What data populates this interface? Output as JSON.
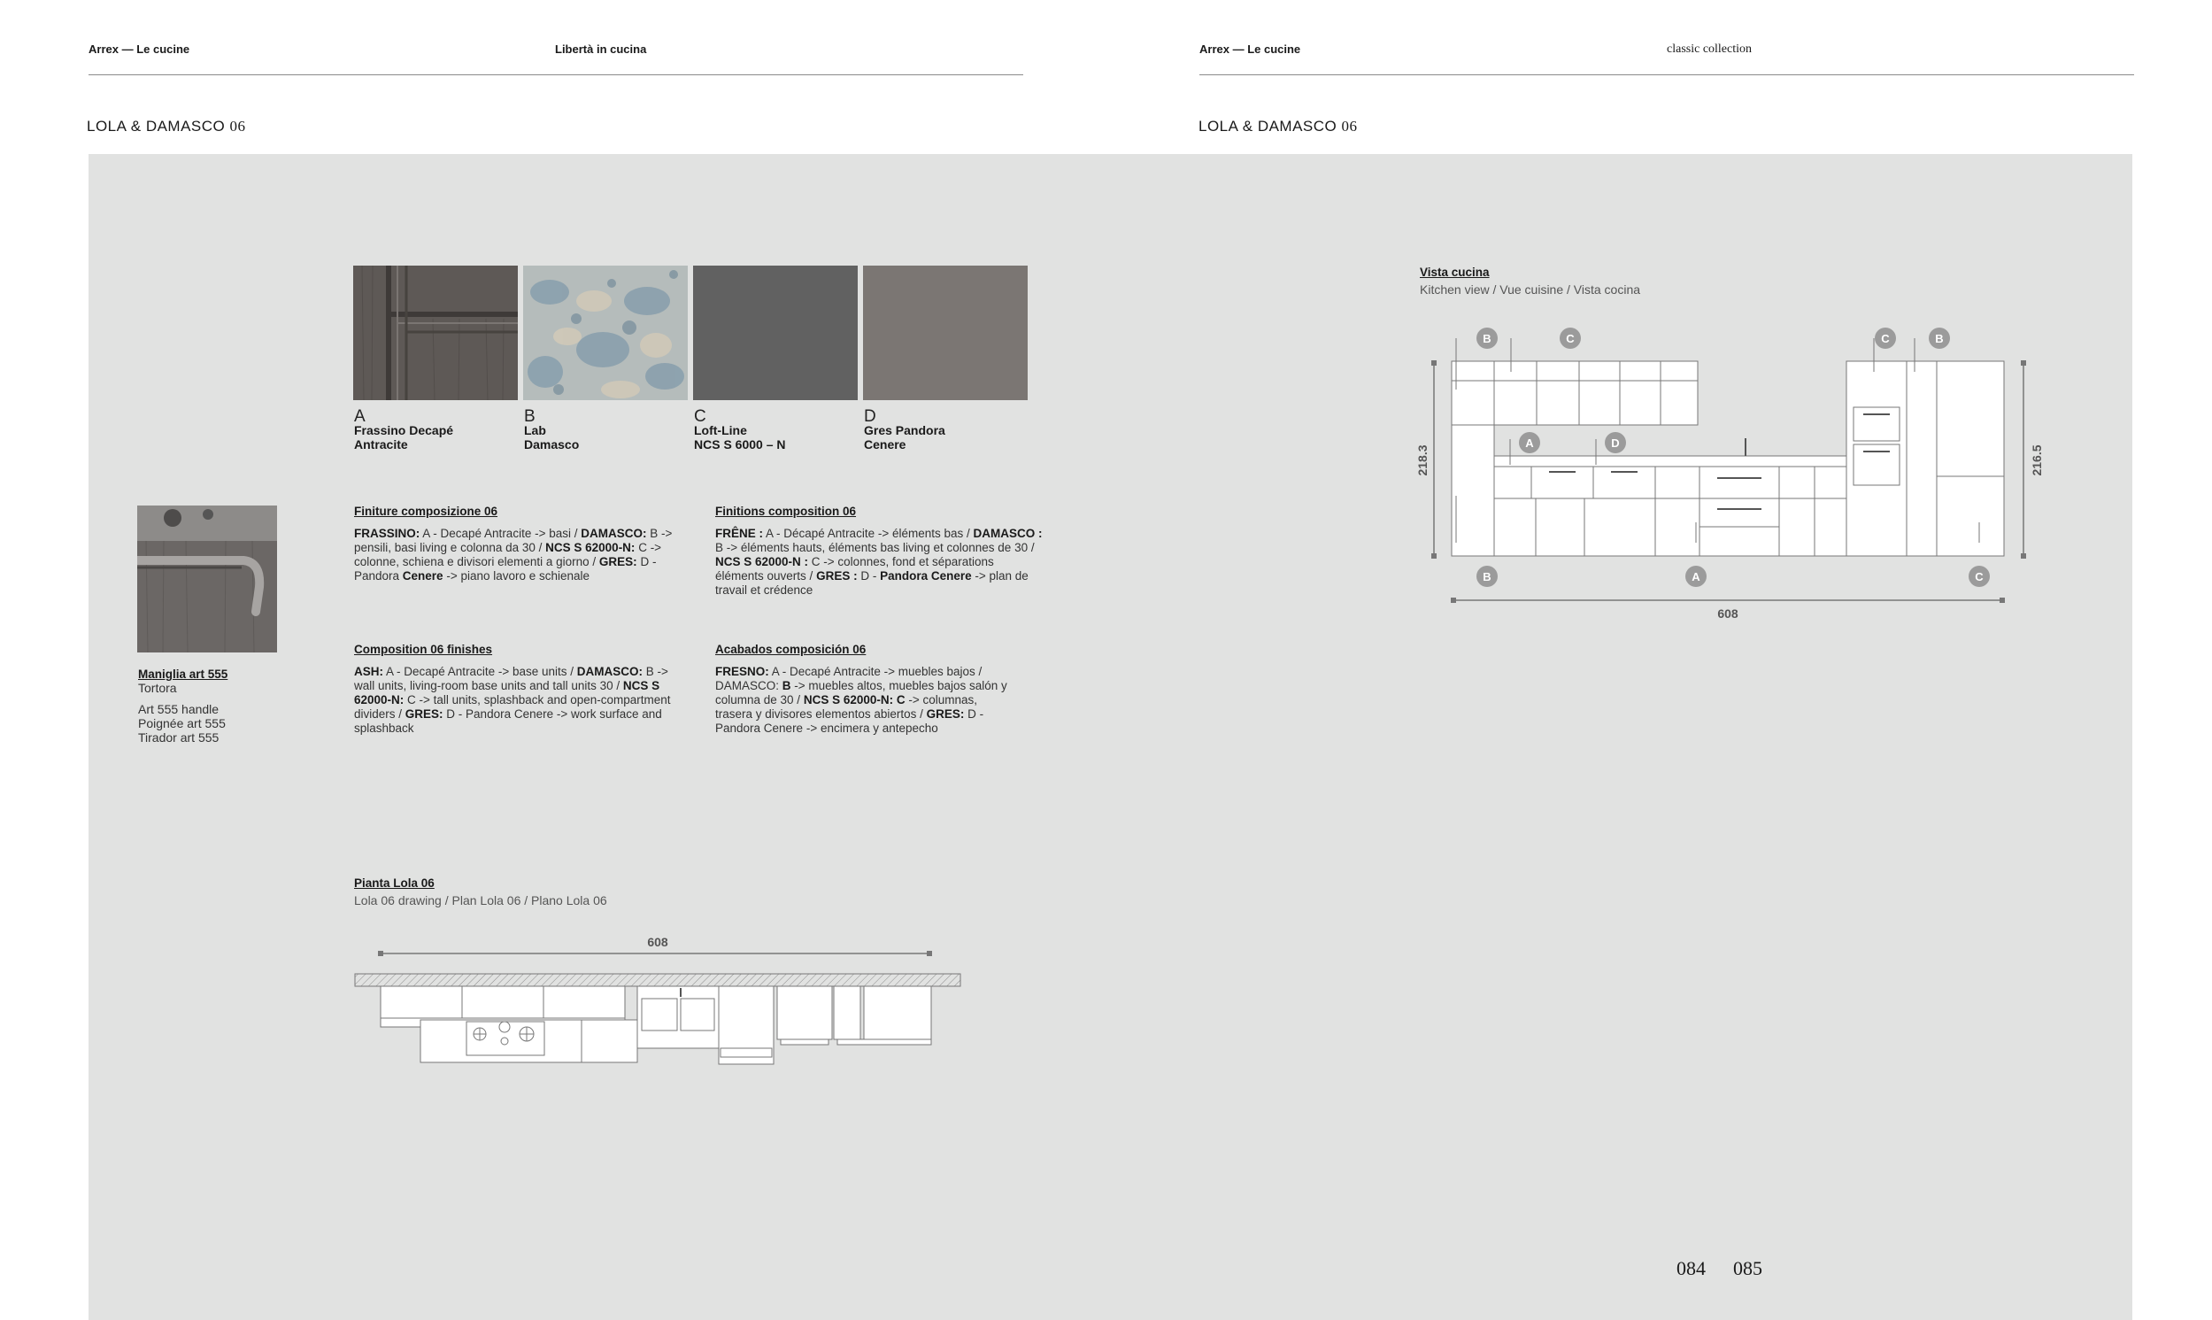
{
  "left_page": {
    "header_brand": "Arrex — Le cucine",
    "header_center": "Libertà in cucina",
    "title": "LOLA & DAMASCO",
    "title_num": "06",
    "swatches": [
      {
        "letter": "A",
        "name": "Frassino Decapé\nAntracite",
        "color": "#5f5a57"
      },
      {
        "letter": "B",
        "name": "Lab\nDamasco",
        "color": "#a9b3b4"
      },
      {
        "letter": "C",
        "name": "Loft-Line\nNCS S 6000 – N",
        "color": "#616161"
      },
      {
        "letter": "D",
        "name": "Gres Pandora\nCenere",
        "color": "#7b7673"
      }
    ],
    "handle": {
      "title": "Maniglia art 555",
      "sub": "Tortora",
      "lines": [
        "Art 555 handle",
        "Poignée art 555",
        "Tirador art 555"
      ]
    },
    "finishes_it": {
      "title": "Finiture composizione 06",
      "html": "<b>FRASSINO:</b> A - Decapé Antracite -> basi / <b>DAMASCO:</b> B -> pensili, basi living e colonna da 30 / <b>NCS S 62000-N:</b> C -> colonne, schiena e divisori elementi a giorno / <b>GRES:</b> D - Pandora <b>Cenere</b> -> piano lavoro e schienale"
    },
    "finishes_fr": {
      "title": "Finitions composition 06",
      "html": "<b>FRÊNE :</b> A - Décapé Antracite -> éléments bas / <b>DAMASCO :</b> B -> éléments hauts, éléments bas living et colonnes de 30 / <b>NCS S 62000-N :</b> C -> colonnes, fond et séparations éléments ouverts / <b>GRES :</b> D - <b>Pandora Cenere</b> -> plan de travail et crédence"
    },
    "finishes_en": {
      "title": "Composition 06 finishes",
      "html": "<b>ASH:</b> A - Decapé Antracite -> base units / <b>DAMASCO:</b> B -> wall units, living-room base units and tall units 30 / <b>NCS S 62000-N:</b> C -> tall units, splashback and open-compartment dividers / <b>GRES:</b> D - Pandora Cenere -> work surface and splashback"
    },
    "finishes_es": {
      "title": "Acabados composición 06",
      "html": "<b>FRESNO:</b> A - Decapé Antracite -> muebles bajos / DAMASCO: <b>B</b> -> muebles altos, muebles bajos salón y columna de 30 / <b>NCS S 62000-N:</b> <b>C</b> -> columnas, trasera y divisores elementos abiertos / <b>GRES:</b> D - Pandora Cenere -> encimera y antepecho"
    },
    "plan": {
      "title": "Pianta Lola 06",
      "sub": "Lola 06 drawing / Plan Lola 06 / Plano Lola 06",
      "dimension": "608"
    },
    "page_number": "084"
  },
  "right_page": {
    "header_brand": "Arrex — Le cucine",
    "header_center": "classic collection",
    "title": "LOLA & DAMASCO",
    "title_num": "06",
    "view": {
      "title": "Vista cucina",
      "sub": "Kitchen view / Vue cuisine / Vista cocina",
      "dim_width": "608",
      "dim_left": "218.3",
      "dim_right": "216.5",
      "markers_top": [
        "B",
        "C",
        "C",
        "B"
      ],
      "markers_mid": [
        "A",
        "D"
      ],
      "markers_bottom": [
        "B",
        "A",
        "C"
      ]
    },
    "page_number": "085"
  }
}
